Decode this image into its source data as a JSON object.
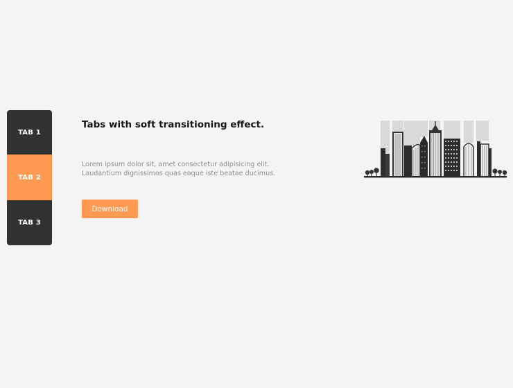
{
  "tabs": [
    {
      "label": "TAB 1",
      "active": false
    },
    {
      "label": "TAB 2",
      "active": true
    },
    {
      "label": "TAB 3",
      "active": false
    }
  ],
  "content": {
    "title": "Tabs with soft transitioning effect.",
    "text": "Lorem ipsum dolor sit, amet consectetur adipisicing elit. Laudantium dignissimos quas eaque iste beatae ducimus.",
    "button_label": "Download"
  },
  "illustration": {
    "icon": "city-skyline-illustration"
  },
  "colors": {
    "accent": "#ff9a52",
    "tab_dark": "#323232",
    "background": "#f4f4f4",
    "title": "#161616",
    "text_muted": "#8c8c8c"
  }
}
